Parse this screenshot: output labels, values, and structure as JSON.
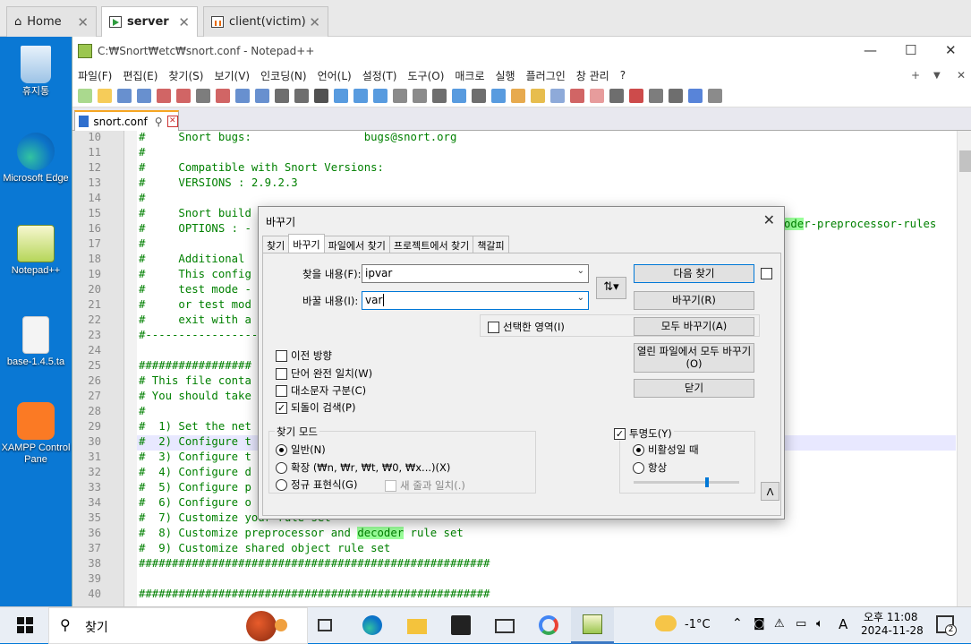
{
  "vm_tabs": [
    {
      "label": "Home"
    },
    {
      "label": "server"
    },
    {
      "label": "client(victim)"
    }
  ],
  "desktop_icons": [
    {
      "label": "휴지통"
    },
    {
      "label": "Microsoft Edge"
    },
    {
      "label": "Notepad++"
    },
    {
      "label": "base-1.4.5.ta"
    },
    {
      "label": "XAMPP Control Pane"
    }
  ],
  "npp": {
    "title": "C:₩Snort₩etc₩snort.conf - Notepad++",
    "menu": [
      "파일(F)",
      "편집(E)",
      "찾기(S)",
      "보기(V)",
      "인코딩(N)",
      "언어(L)",
      "설정(T)",
      "도구(O)",
      "매크로",
      "실행",
      "플러그인",
      "창 관리",
      "?"
    ],
    "doc_tab": "snort.conf"
  },
  "editor_lines": [
    {
      "n": "10",
      "text": "#     Snort bugs:                 bugs@snort.org"
    },
    {
      "n": "11",
      "text": "#"
    },
    {
      "n": "12",
      "text": "#     Compatible with Snort Versions:"
    },
    {
      "n": "13",
      "text": "#     VERSIONS : 2.9.2.3"
    },
    {
      "n": "14",
      "text": "#"
    },
    {
      "n": "15",
      "text": "#     Snort build"
    },
    {
      "n": "16",
      "text": "#     OPTIONS : -"
    },
    {
      "n": "17",
      "text": "#"
    },
    {
      "n": "18",
      "text": "#     Additional"
    },
    {
      "n": "19",
      "text": "#     This config"
    },
    {
      "n": "20",
      "text": "#     test mode -"
    },
    {
      "n": "21",
      "text": "#     or test mod"
    },
    {
      "n": "22",
      "text": "#     exit with a"
    },
    {
      "n": "23",
      "text": "#-----------------"
    },
    {
      "n": "24",
      "text": ""
    },
    {
      "n": "25",
      "text": "#################"
    },
    {
      "n": "26",
      "text": "# This file conta"
    },
    {
      "n": "27",
      "text": "# You should take"
    },
    {
      "n": "28",
      "text": "#"
    },
    {
      "n": "29",
      "text": "#  1) Set the net"
    },
    {
      "n": "30",
      "text": "#  2) Configure t"
    },
    {
      "n": "31",
      "text": "#  3) Configure t"
    },
    {
      "n": "32",
      "text": "#  4) Configure d"
    },
    {
      "n": "33",
      "text": "#  5) Configure p"
    },
    {
      "n": "34",
      "text": "#  6) Configure o"
    },
    {
      "n": "35",
      "text": "#  7) Customize your rule set"
    },
    {
      "n": "36",
      "pre": "#  8) Customize preprocessor and ",
      "hl": "decoder",
      "post": " rule set"
    },
    {
      "n": "37",
      "text": "#  9) Customize shared object rule set"
    },
    {
      "n": "38",
      "text": "#####################################################"
    },
    {
      "n": "39",
      "text": ""
    },
    {
      "n": "40",
      "text": "#####################################################"
    }
  ],
  "line16_tail": {
    "hl": "ode",
    "post": "r-preprocessor-rules"
  },
  "dialog": {
    "title": "바꾸기",
    "tabs": [
      "찾기",
      "바꾸기",
      "파일에서 찾기",
      "프로젝트에서 찾기",
      "책갈피"
    ],
    "find_label": "찾을 내용(F):",
    "find_value": "ipvar",
    "replace_label": "바꿀 내용(I):",
    "replace_value": "var",
    "in_selection": "선택한 영역(I)",
    "buttons": {
      "find_next": "다음 찾기",
      "replace": "바꾸기(R)",
      "replace_all": "모두 바꾸기(A)",
      "replace_all_open": "열린 파일에서 모두 바꾸기\n(O)",
      "close": "닫기"
    },
    "options": [
      {
        "label": "이전 방향",
        "checked": false
      },
      {
        "label": "단어 완전 일치(W)",
        "checked": false
      },
      {
        "label": "대소문자 구분(C)",
        "checked": false
      },
      {
        "label": "되돌이 검색(P)",
        "checked": true
      }
    ],
    "mode_title": "찾기 모드",
    "modes": [
      {
        "label": "일반(N)",
        "on": true
      },
      {
        "label": "확장 (₩n, ₩r, ₩t, ₩0, ₩x...)(X)",
        "on": false
      },
      {
        "label": "정규 표현식(G)",
        "on": false
      }
    ],
    "newline_match": "새 줄과 일치(.)",
    "transparency": "투명도(Y)",
    "trans_opts": [
      {
        "label": "비활성일 때",
        "on": true
      },
      {
        "label": "항상",
        "on": false
      }
    ],
    "slider_level": 0.7
  },
  "taskbar": {
    "search": "찾기",
    "weather": "-1°C",
    "time": "오후 11:08",
    "date": "2024-11-28",
    "ime": "A",
    "badge": "2"
  }
}
